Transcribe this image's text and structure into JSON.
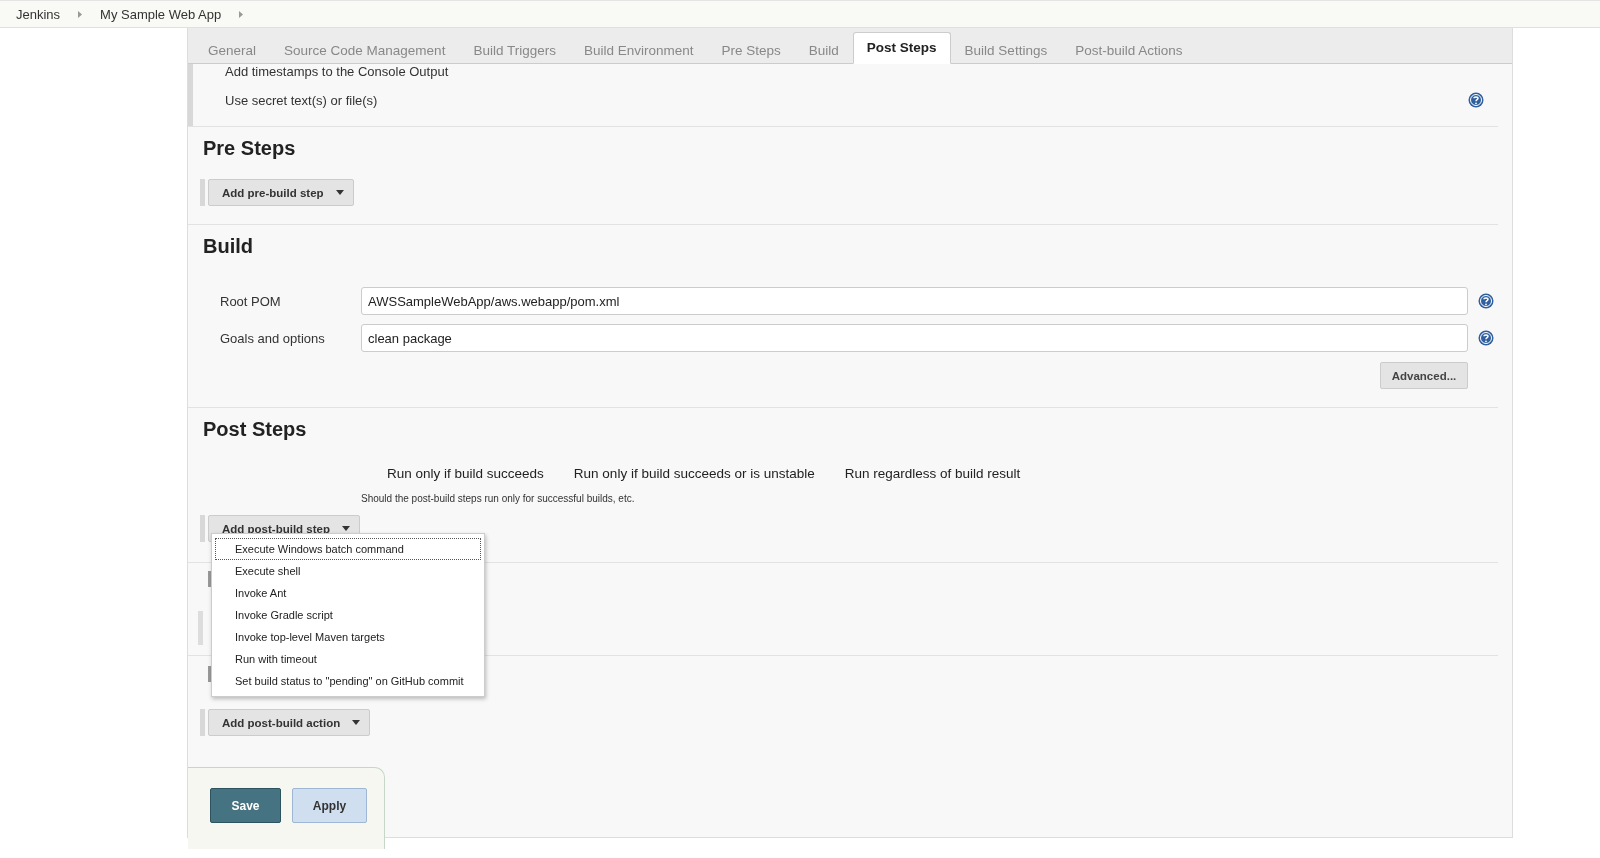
{
  "breadcrumbs": [
    "Jenkins",
    "My Sample Web App"
  ],
  "tabs": [
    {
      "label": "General",
      "selected": false
    },
    {
      "label": "Source Code Management",
      "selected": false
    },
    {
      "label": "Build Triggers",
      "selected": false
    },
    {
      "label": "Build Environment",
      "selected": false
    },
    {
      "label": "Pre Steps",
      "selected": false
    },
    {
      "label": "Build",
      "selected": false
    },
    {
      "label": "Post Steps",
      "selected": true
    },
    {
      "label": "Build Settings",
      "selected": false
    },
    {
      "label": "Post-build Actions",
      "selected": false
    }
  ],
  "build_environment": {
    "options": [
      "Add timestamps to the Console Output",
      "Use secret text(s) or file(s)"
    ]
  },
  "pre_steps": {
    "heading": "Pre Steps",
    "button": "Add pre-build step"
  },
  "build": {
    "heading": "Build",
    "fields": [
      {
        "label": "Root POM",
        "value": "AWSSampleWebApp/aws.webapp/pom.xml"
      },
      {
        "label": "Goals and options",
        "value": "clean package"
      }
    ],
    "button": "Advanced..."
  },
  "post_steps": {
    "heading": "Post Steps",
    "options": [
      "Run only if build succeeds",
      "Run only if build succeeds or is unstable",
      "Run regardless of build result"
    ],
    "hint": "Should the post-build steps run only for successful builds, etc.",
    "button": "Add post-build step",
    "menu": [
      {
        "label": "Execute Windows batch command",
        "selected": true
      },
      {
        "label": "Execute shell",
        "selected": false
      },
      {
        "label": "Invoke Ant",
        "selected": false
      },
      {
        "label": "Invoke Gradle script",
        "selected": false
      },
      {
        "label": "Invoke top-level Maven targets",
        "selected": false
      },
      {
        "label": "Run with timeout",
        "selected": false
      },
      {
        "label": "Set build status to \"pending\" on GitHub commit",
        "selected": false
      }
    ]
  },
  "post_build_actions": {
    "button": "Add post-build action"
  },
  "footer_buttons": [
    {
      "label": "Save",
      "kind": "primary"
    },
    {
      "label": "Apply",
      "kind": "secondary"
    }
  ]
}
